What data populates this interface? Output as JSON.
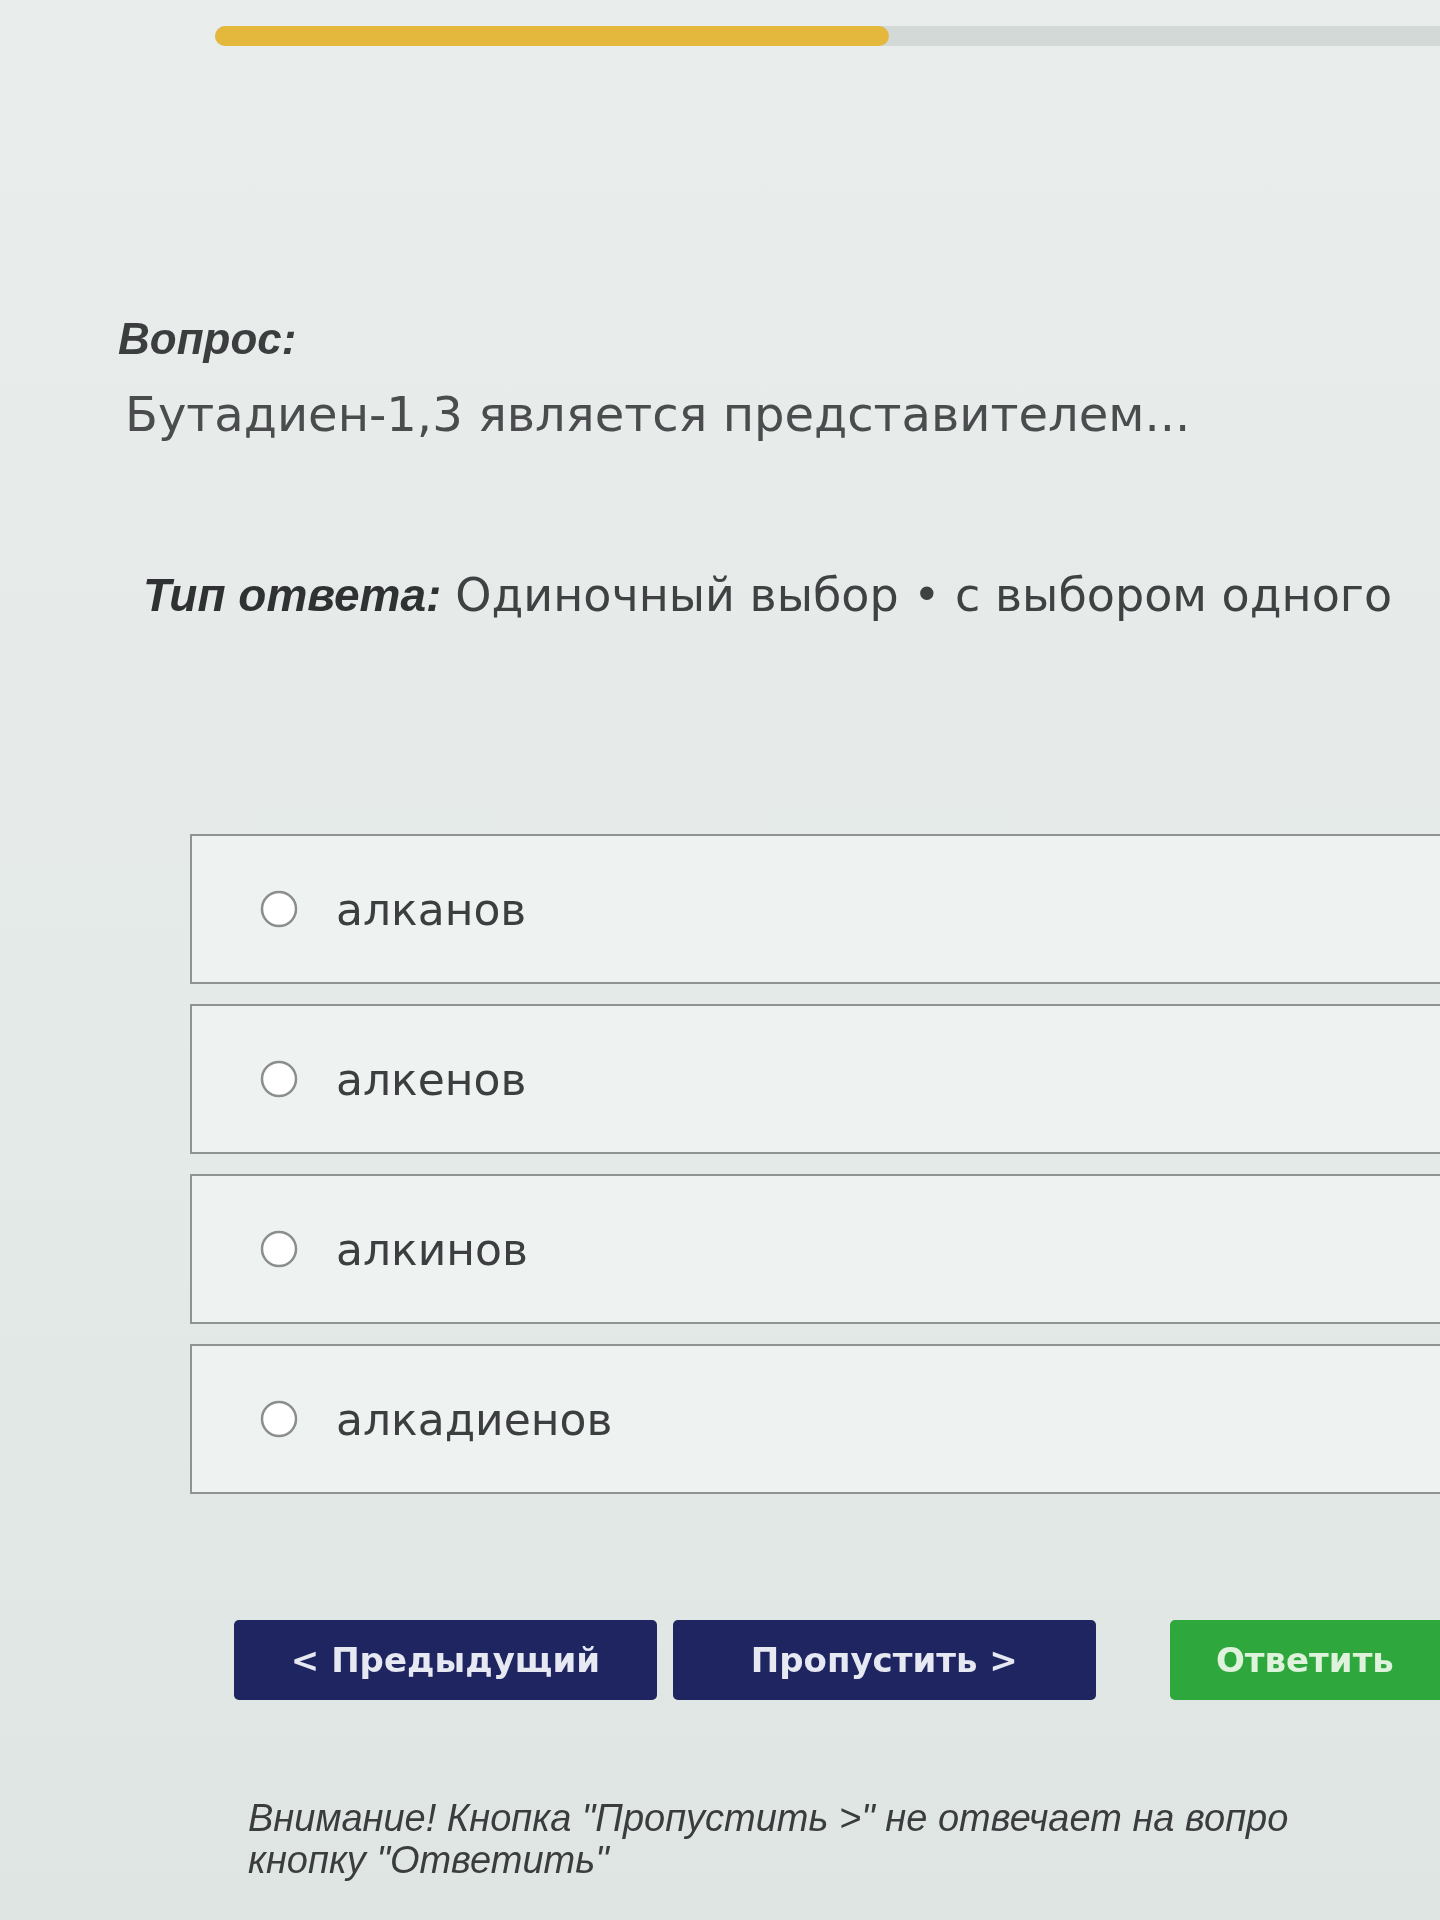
{
  "progress": {
    "level": 0.55
  },
  "question": {
    "heading": "Вопрос:",
    "text": "Бутадиен-1,3 является представителем..."
  },
  "answer_type": {
    "label": "Тип ответа:",
    "value": "Одиночный выбор • с выбором одного"
  },
  "options": [
    {
      "label": "алканов",
      "selected": false
    },
    {
      "label": "алкенов",
      "selected": false
    },
    {
      "label": "алкинов",
      "selected": false
    },
    {
      "label": "алкадиенов",
      "selected": false
    }
  ],
  "buttons": [
    {
      "label": "< Предыдущий",
      "kind": "secondary"
    },
    {
      "label": "Пропустить >",
      "kind": "secondary"
    },
    {
      "label": "Ответить",
      "kind": "primary"
    }
  ],
  "notice": {
    "lines": [
      "Внимание! Кнопка \"Пропустить >\" не отвечает на вопро",
      "кнопку \"Ответить\""
    ]
  }
}
